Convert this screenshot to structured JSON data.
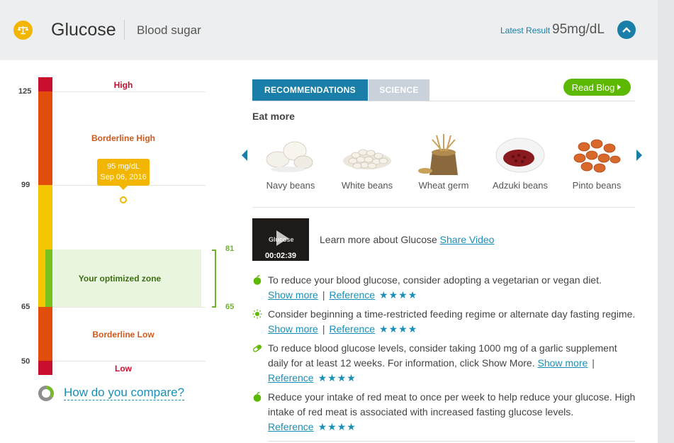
{
  "header": {
    "title": "Glucose",
    "subtitle": "Blood sugar",
    "latest_label": "Latest Result",
    "latest_value": "95mg/dL"
  },
  "gauge": {
    "ticks": [
      "125",
      "99",
      "65",
      "50"
    ],
    "zones": {
      "high": "High",
      "borderline_high": "Borderline High",
      "optimized": "Your optimized zone",
      "borderline_low": "Borderline Low",
      "low": "Low"
    },
    "optimized_range": {
      "max": "81",
      "min": "65"
    },
    "result": {
      "value_text": "95 mg/dL",
      "date": "Sep 06, 2016",
      "value": 95
    },
    "compare_link": "How do you compare?",
    "colors": {
      "red": "#c8102e",
      "orange": "#e24d0c",
      "yellow": "#f5c400",
      "green": "#78c11f"
    }
  },
  "tabs": {
    "recommendations": "RECOMMENDATIONS",
    "science": "SCIENCE",
    "read_blog": "Read Blog"
  },
  "eat_more": {
    "title": "Eat more",
    "foods": [
      {
        "label": "Navy beans",
        "icon": "navy-beans-image"
      },
      {
        "label": "White beans",
        "icon": "white-beans-image"
      },
      {
        "label": "Wheat germ",
        "icon": "wheat-germ-image"
      },
      {
        "label": "Adzuki beans",
        "icon": "adzuki-beans-image"
      },
      {
        "label": "Pinto beans",
        "icon": "pinto-beans-image"
      }
    ]
  },
  "video": {
    "thumb_word": "Glucose",
    "duration": "00:02:39",
    "text": "Learn more about Glucose",
    "share": "Share Video"
  },
  "recommendations": [
    {
      "icon": "apple-icon",
      "text": "To reduce your blood glucose, consider adopting a vegetarian or vegan diet.",
      "show_more": "Show more",
      "reference": "Reference",
      "stars": "★★★★"
    },
    {
      "icon": "sun-icon",
      "text": "Consider beginning a time-restricted feeding regime or alternate day fasting regime.",
      "show_more": "Show more",
      "reference": "Reference",
      "stars": "★★★★"
    },
    {
      "icon": "pill-icon",
      "text": "To reduce blood glucose levels, consider taking 1000 mg of a garlic supplement daily for at least 12 weeks. For information, click Show More.",
      "show_more": "Show more",
      "reference": "Reference",
      "stars": "★★★★"
    },
    {
      "icon": "apple-icon",
      "text": "Reduce your intake of red meat to once per week to help reduce your glucose. High intake of red meat is associated with increased fasting glucose levels.",
      "reference": "Reference",
      "stars": "★★★★"
    }
  ]
}
